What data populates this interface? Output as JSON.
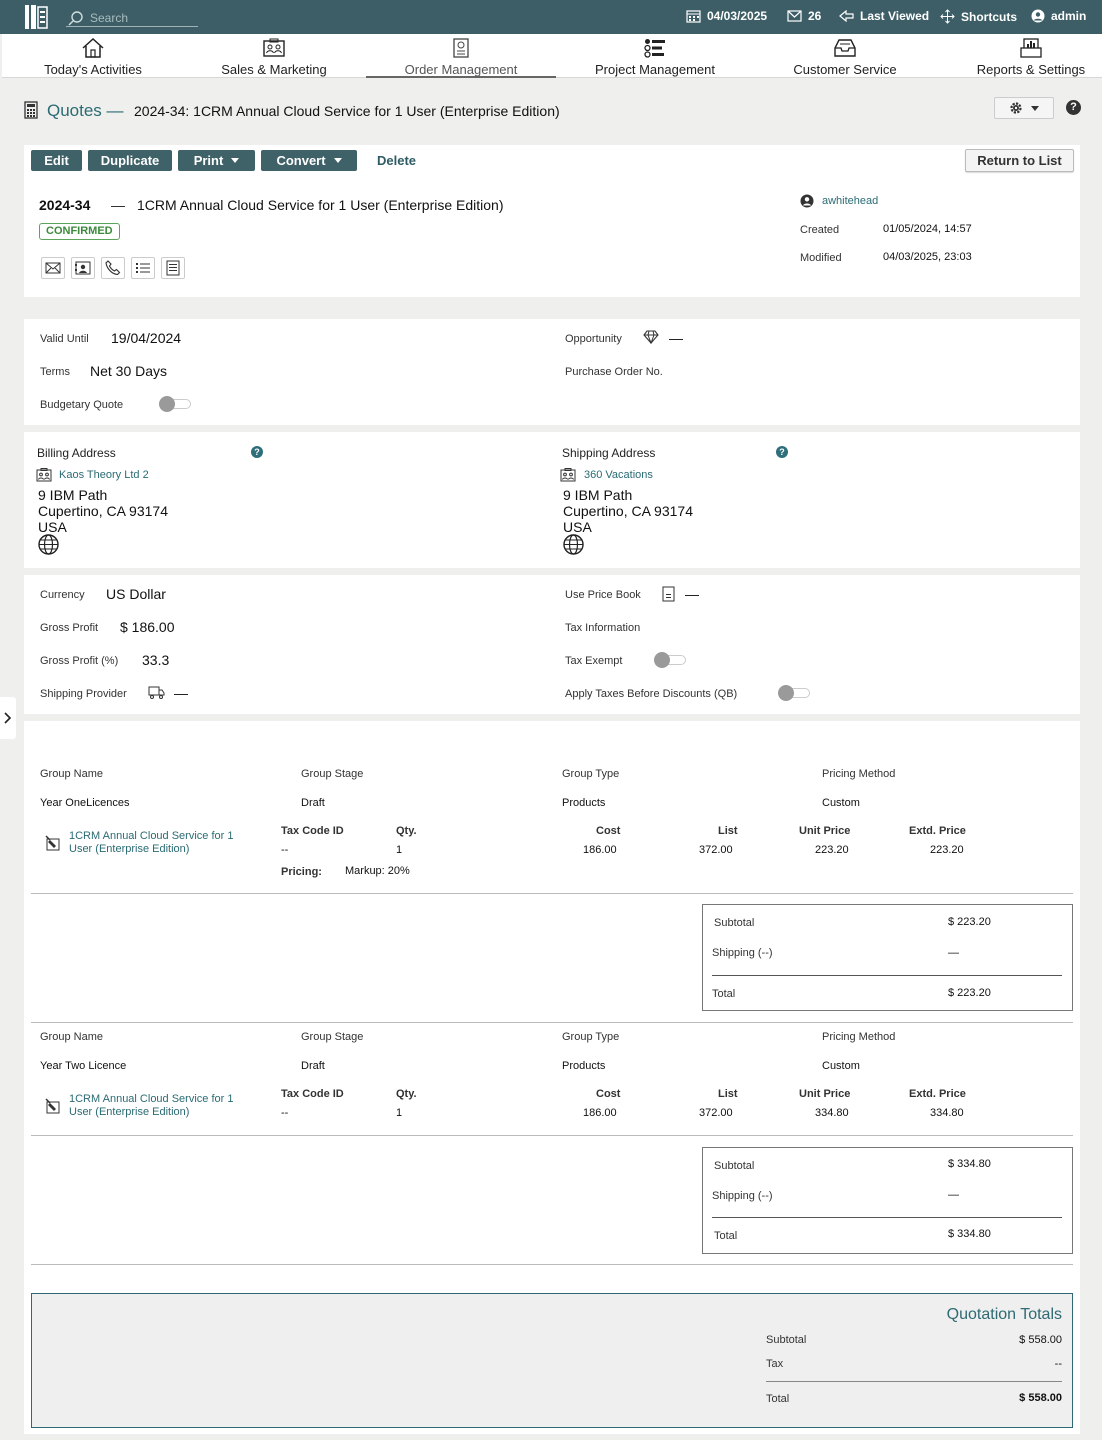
{
  "topbar": {
    "search_placeholder": "Search",
    "date": "04/03/2025",
    "mail_count": "26",
    "last_viewed": "Last Viewed",
    "shortcuts": "Shortcuts",
    "user": "admin"
  },
  "modules": [
    {
      "label": "Today's Activities",
      "icon": "home-icon"
    },
    {
      "label": "Sales & Marketing",
      "icon": "people-icon"
    },
    {
      "label": "Order Management",
      "icon": "order-icon",
      "active": true
    },
    {
      "label": "Project Management",
      "icon": "tasks-icon"
    },
    {
      "label": "Customer Service",
      "icon": "inbox-icon"
    },
    {
      "label": "Reports & Settings",
      "icon": "reports-icon"
    }
  ],
  "breadcrumb": {
    "module": "Quotes",
    "separator": "—",
    "record": "2024-34: 1CRM Annual Cloud Service for 1 User (Enterprise Edition)"
  },
  "actions": {
    "edit": "Edit",
    "duplicate": "Duplicate",
    "print": "Print",
    "convert": "Convert",
    "delete": "Delete",
    "return": "Return to List"
  },
  "header": {
    "number": "2024-34",
    "dash": "—",
    "name": "1CRM Annual Cloud Service for 1 User (Enterprise Edition)",
    "status": "CONFIRMED",
    "owner": "awhitehead",
    "created_label": "Created",
    "created": "01/05/2024, 14:57",
    "modified_label": "Modified",
    "modified": "04/03/2025, 23:03"
  },
  "details": {
    "valid_until_label": "Valid Until",
    "valid_until": "19/04/2024",
    "terms_label": "Terms",
    "terms": "Net 30 Days",
    "budgetary_label": "Budgetary Quote",
    "budgetary": false,
    "opportunity_label": "Opportunity",
    "opportunity": "—",
    "po_label": "Purchase Order No."
  },
  "addresses": {
    "billing_label": "Billing Address",
    "billing_account": "Kaos Theory Ltd 2",
    "billing_street": "9 IBM Path",
    "billing_city": "Cupertino, CA 93174",
    "billing_country": "USA",
    "shipping_label": "Shipping Address",
    "shipping_account": "360 Vacations",
    "shipping_street": "9 IBM Path",
    "shipping_city": "Cupertino, CA 93174",
    "shipping_country": "USA"
  },
  "financial": {
    "currency_label": "Currency",
    "currency": "US Dollar",
    "gross_profit_label": "Gross Profit",
    "gross_profit": "$ 186.00",
    "gross_profit_pct_label": "Gross Profit (%)",
    "gross_profit_pct": "33.3",
    "shipping_provider_label": "Shipping Provider",
    "shipping_provider": "—",
    "price_book_label": "Use Price Book",
    "price_book": "—",
    "tax_info_label": "Tax Information",
    "tax_exempt_label": "Tax Exempt",
    "tax_exempt": false,
    "apply_taxes_label": "Apply Taxes Before Discounts (QB)",
    "apply_taxes": false
  },
  "group_headers": {
    "name": "Group Name",
    "stage": "Group Stage",
    "type": "Group Type",
    "pricing": "Pricing Method"
  },
  "line_headers": {
    "tax_code": "Tax Code ID",
    "qty": "Qty.",
    "cost": "Cost",
    "list": "List",
    "unit_price": "Unit Price",
    "extd_price": "Extd. Price",
    "pricing": "Pricing:"
  },
  "groups": [
    {
      "name": "Year OneLicences",
      "stage": "Draft",
      "type": "Products",
      "pricing": "Custom",
      "line": {
        "product": "1CRM Annual Cloud Service for 1 User (Enterprise Edition)",
        "product_l1": "1CRM Annual Cloud Service for 1",
        "product_l2": "User (Enterprise Edition)",
        "tax_code": "--",
        "qty": "1",
        "cost": "186.00",
        "list": "372.00",
        "unit_price": "223.20",
        "extd_price": "223.20",
        "markup": "Markup: 20%"
      },
      "totals": {
        "subtotal_label": "Subtotal",
        "subtotal": "$ 223.20",
        "shipping_label": "Shipping (--)",
        "shipping": "—",
        "total_label": "Total",
        "total": "$ 223.20"
      }
    },
    {
      "name": "Year Two Licence",
      "stage": "Draft",
      "type": "Products",
      "pricing": "Custom",
      "line": {
        "product": "1CRM Annual Cloud Service for 1 User (Enterprise Edition)",
        "product_l1": "1CRM Annual Cloud Service for 1",
        "product_l2": "User (Enterprise Edition)",
        "tax_code": "--",
        "qty": "1",
        "cost": "186.00",
        "list": "372.00",
        "unit_price": "334.80",
        "extd_price": "334.80"
      },
      "totals": {
        "subtotal_label": "Subtotal",
        "subtotal": "$ 334.80",
        "shipping_label": "Shipping (--)",
        "shipping": "—",
        "total_label": "Total",
        "total": "$ 334.80"
      }
    }
  ],
  "quotation_totals": {
    "title": "Quotation Totals",
    "subtotal_label": "Subtotal",
    "subtotal": "$ 558.00",
    "tax_label": "Tax",
    "tax": "--",
    "total_label": "Total",
    "total": "$ 558.00"
  },
  "colors": {
    "topbar": "#3d5e66",
    "button": "#3f6168",
    "link": "#2a6b73",
    "confirmed": "#3c8a3c"
  }
}
